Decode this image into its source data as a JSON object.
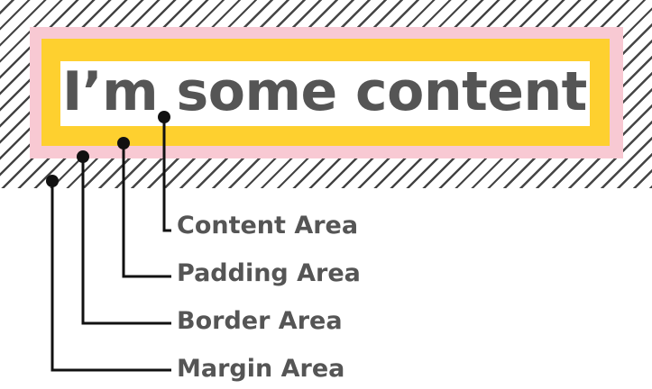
{
  "diagram": {
    "content_text": "I’m some content",
    "labels": {
      "content": "Content Area",
      "padding": "Padding Area",
      "border": "Border Area",
      "margin": "Margin Area"
    },
    "colors": {
      "margin_hatch": "#444444",
      "border": "#f8c9d3",
      "padding": "#fed02f",
      "content": "#ffffff",
      "text": "#555555",
      "leader": "#111111"
    }
  }
}
